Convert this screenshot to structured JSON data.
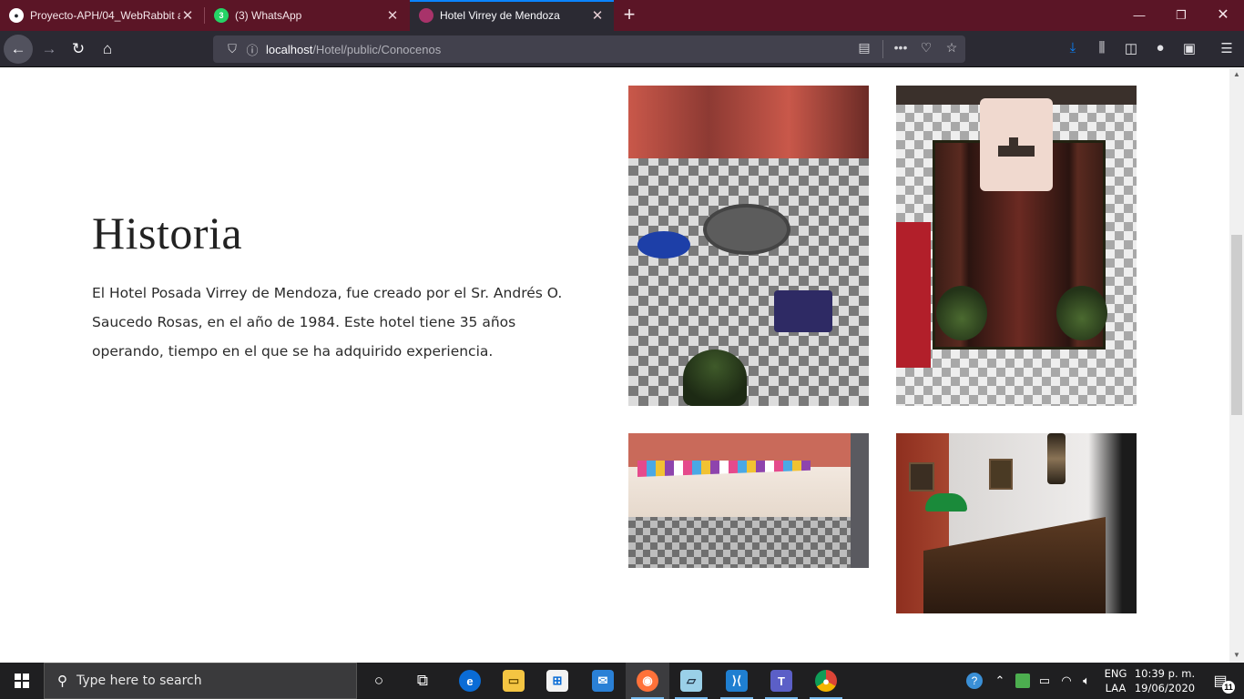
{
  "browser": {
    "tabs": [
      {
        "title": "Proyecto-APH/04_WebRabbit a",
        "icon": "github-icon",
        "active": false
      },
      {
        "title": "(3) WhatsApp",
        "icon": "whatsapp-icon",
        "badge": "3",
        "active": false
      },
      {
        "title": "Hotel Virrey de Mendoza",
        "icon": "site-favicon-icon",
        "active": true
      }
    ],
    "url_host": "localhost",
    "url_path": "/Hotel/public/Conocenos",
    "colors": {
      "tabbar": "#5b1526",
      "toolbar": "#2b2a33",
      "accent": "#0a84ff"
    }
  },
  "page": {
    "heading": "Historia",
    "paragraph": "El Hotel Posada Virrey de Mendoza, fue creado por el Sr. Andrés O. Saucedo Rosas, en el año de 1984. Este hotel tiene 35 años operando, tiempo en el que se ha adquirido experiencia."
  },
  "taskbar": {
    "search_placeholder": "Type here to search",
    "apps": [
      "cortana-icon",
      "task-view-icon",
      "edge-icon",
      "file-explorer-icon",
      "store-icon",
      "mail-icon",
      "firefox-icon",
      "notepad-icon",
      "vscode-icon",
      "teams-icon",
      "chrome-icon"
    ],
    "lang_line1": "ENG",
    "lang_line2": "LAA",
    "time": "10:39 p. m.",
    "date": "19/06/2020",
    "notification_count": "11"
  }
}
